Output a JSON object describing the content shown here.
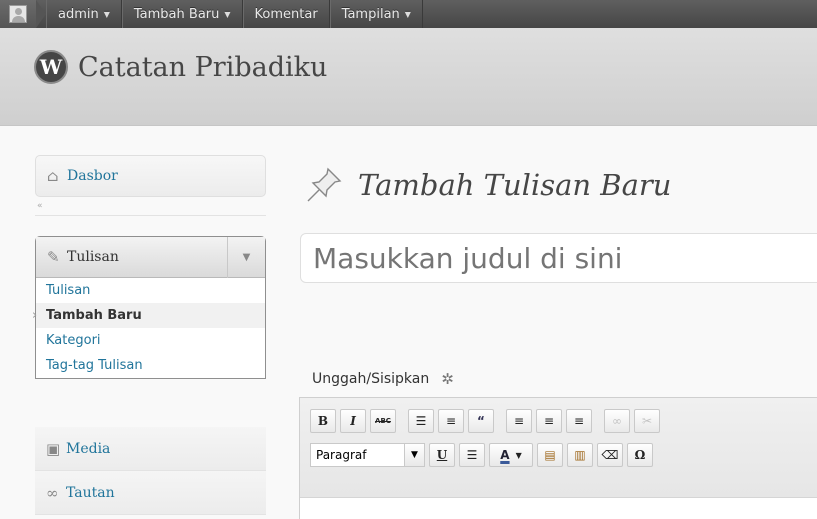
{
  "adminbar": {
    "user_label": "admin",
    "new_label": "Tambah Baru",
    "comments_label": "Komentar",
    "appearance_label": "Tampilan",
    "caret": "▼"
  },
  "header": {
    "site_title": "Catatan Pribadiku",
    "logo_letter": "W"
  },
  "sidebar": {
    "dashboard_label": "Dasbor",
    "collapse_label": "«",
    "posts_label": "Tulisan",
    "posts_submenu": [
      {
        "label": "Tulisan"
      },
      {
        "label": "Tambah Baru"
      },
      {
        "label": "Kategori"
      },
      {
        "label": "Tag-tag Tulisan"
      }
    ],
    "media_label": "Media",
    "links_label": "Tautan"
  },
  "main": {
    "page_title": "Tambah Tulisan Baru",
    "title_placeholder": "Masukkan judul di sini",
    "upload_label": "Unggah/Sisipkan"
  },
  "editor": {
    "format_select": "Paragraf",
    "bold": "B",
    "italic": "I",
    "strikethrough": "ABC",
    "underline": "U",
    "text_color": "A",
    "special_char": "Ω"
  },
  "colors": {
    "link": "#21759b",
    "adminbar": "#464646",
    "header_bg": "#d9d9d9"
  }
}
